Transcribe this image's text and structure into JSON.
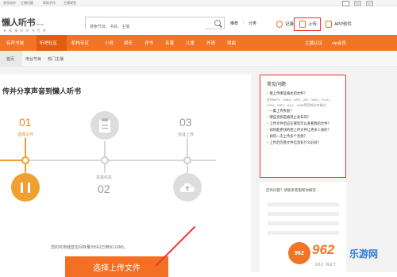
{
  "topbar": {
    "links": [
      "发现动作",
      "主播问题",
      "帮助合作",
      "主播课堂"
    ]
  },
  "header": {
    "logo": "懒人听书",
    "logo_sub": "lrts.me",
    "slogan": "有 故 事 的 听 书 世 界",
    "search_placeholder": "搜索节目、书目、主播",
    "links": [
      "推荐",
      "分类"
    ],
    "record": "记录",
    "upload": "上传",
    "app": "APP软件"
  },
  "nav": {
    "items": [
      "有声书城",
      "听吧社区",
      "机构专区",
      "小说",
      "娱乐",
      "评书",
      "名著",
      "儿童",
      "外语",
      "戏曲",
      "主播认证",
      "vip会员"
    ]
  },
  "subnav": {
    "items": [
      "首页",
      "电台节目",
      "热门主播"
    ]
  },
  "panel": {
    "title": "传并分享声音到懒人听书",
    "steps": [
      {
        "num": "01",
        "label": "选择文件"
      },
      {
        "num": "02",
        "label": ""
      },
      {
        "num": "03",
        "label": "完成上传"
      }
    ],
    "mid_label": "完善信息",
    "mid_num": "02",
    "note": "您的可用储音空间存量为5G(已用50.16M)，",
    "upload_button": "选择上传文件"
  },
  "faq": {
    "title": "常见问题",
    "items": [
      {
        "q": "能上传哪些格式的文件？",
        "sub": [
          "支持MP3、WMA、APE、AIF、WAV、FLAC、",
          "OGG、MP2、AAC、AMR等音频文件格式"
        ]
      },
      {
        "q": "一集上传失败？",
        "sub": []
      },
      {
        "q": "哪些音频是被禁止发布的？",
        "sub": []
      },
      {
        "q": "上传文件后应在哪里可以查看我的文件？",
        "sub": []
      },
      {
        "q": "如何能更快的把上传文件让更多人收听？",
        "sub": []
      },
      {
        "q": "如何一次上传多个音频？",
        "sub": []
      },
      {
        "q": "上传后完善文件信息有什么好处？",
        "sub": []
      }
    ]
  },
  "side2": {
    "text": "还有问题？请联系客服帮你解答："
  },
  "watermark": {
    "badge": "962",
    "site": "962",
    "cn": "乐游网",
    "url": "962.NET"
  },
  "colors": {
    "orange": "#f27427",
    "highlight_red": "#e33333"
  }
}
